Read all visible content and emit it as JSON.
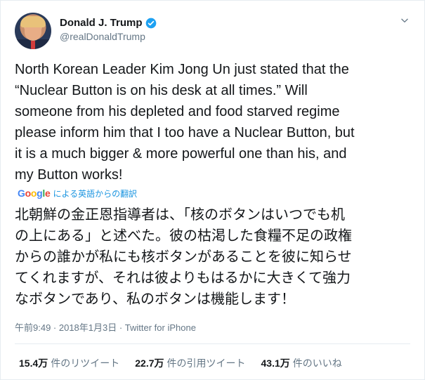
{
  "user": {
    "display_name": "Donald J. Trump",
    "handle": "@realDonaldTrump",
    "verified": true,
    "verified_color": "#1da1f2"
  },
  "tweet": {
    "text": "North Korean Leader Kim Jong Un just stated that the\n“Nuclear Button is on his desk at all times.” Will\nsomeone from his depleted and food starved regime\nplease inform him that I too have a Nuclear Button, but\nit is a much bigger & more powerful one than his, and\nmy Button works!"
  },
  "translation": {
    "provider_logo": [
      "G",
      "o",
      "o",
      "g",
      "l",
      "e"
    ],
    "label": "による英語からの翻訳",
    "text": "北朝鮮の金正恩指導者は、「核のボタンはいつでも机\nの上にある」と述べた。彼の枯渇した食糧不足の政権\nからの誰かが私にも核ボタンがあることを彼に知らせ\nてくれますが、それは彼よりもはるかに大きくて強力\nなボタンであり、私のボタンは機能します！"
  },
  "meta": {
    "timestamp": "午前9:49 · 2018年1月3日 · Twitter for iPhone"
  },
  "stats": [
    {
      "count": "15.4万",
      "label": "件のリツイート"
    },
    {
      "count": "22.7万",
      "label": "件の引用ツイート"
    },
    {
      "count": "43.1万",
      "label": "件のいいね"
    }
  ],
  "icons": {
    "menu": "chevron-down-icon",
    "verified": "verified-badge-icon"
  }
}
